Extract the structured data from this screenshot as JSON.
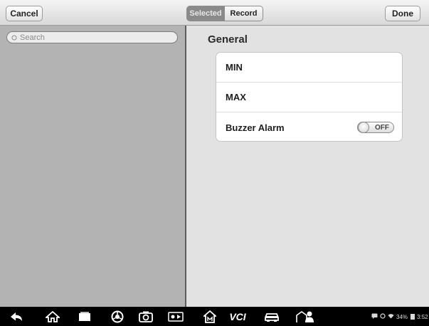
{
  "toolbar": {
    "cancel_label": "Cancel",
    "segments": [
      "Selected",
      "Record"
    ],
    "done_label": "Done"
  },
  "search": {
    "placeholder": "Search"
  },
  "settings": {
    "section_title": "General",
    "rows": [
      {
        "label": "MIN"
      },
      {
        "label": "MAX"
      },
      {
        "label": "Buzzer Alarm",
        "toggle": "OFF"
      }
    ]
  },
  "navbar": {
    "icons": [
      "back-icon",
      "home-icon",
      "recent-apps-icon",
      "browser-icon",
      "camera-icon",
      "display-icon",
      "maxisys-home-icon",
      "vci-icon",
      "car-icon",
      "service-shop-icon"
    ],
    "vci_label": "VCI",
    "battery": "34%",
    "time": "3:52"
  }
}
